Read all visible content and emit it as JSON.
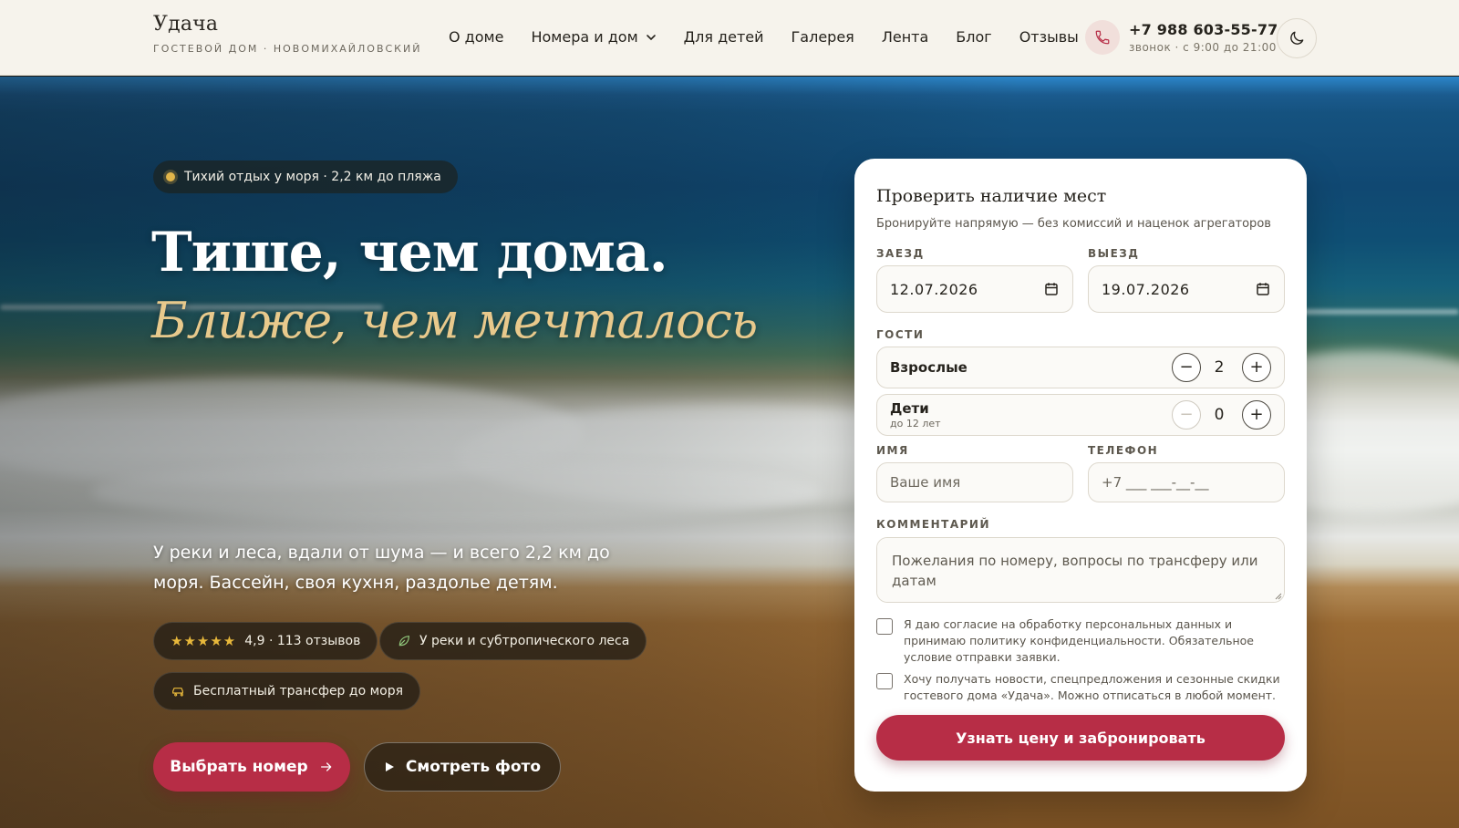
{
  "brand": {
    "name": "Удача",
    "subtitle": "ГОСТЕВОЙ ДОМ · НОВОМИХАЙЛОВСКИЙ"
  },
  "nav": {
    "about": "О доме",
    "rooms": "Номера и дом",
    "kids": "Для детей",
    "gallery": "Галерея",
    "feed": "Лента",
    "blog": "Блог",
    "reviews": "Отзывы"
  },
  "contact": {
    "phone": "+7 988 603-55-77",
    "hours": "звонок · с 9:00 до 21:00",
    "phone_icon": "phone-icon"
  },
  "theme_toggle": {
    "icon": "moon-icon"
  },
  "hero": {
    "badge": "Тихий отдых у моря · 2,2 км до пляжа",
    "title": "Тише, чем дома.",
    "title_accent": "Ближе, чем мечталось",
    "lead": "У реки и леса, вдали от шума — и всего 2,2 км до моря. Бассейн, своя кухня, раздолье детям.",
    "chips": {
      "rating": {
        "stars": "★★★★★",
        "text": "4,9 · 113 отзывов"
      },
      "nature": {
        "text": "У реки и субтропического леса",
        "icon": "leaf-icon"
      },
      "transfer": {
        "text": "Бесплатный трансфер до моря",
        "icon": "car-icon"
      }
    },
    "btn_primary": "Выбрать номер",
    "btn_secondary": "Смотреть фото"
  },
  "booking": {
    "title": "Проверить наличие мест",
    "subtitle": "Бронируйте напрямую — без комиссий и наценок агрегаторов",
    "checkin_label": "ЗАЕЗД",
    "checkin_value": "12.07.2026",
    "checkout_label": "ВЫЕЗД",
    "checkout_value": "19.07.2026",
    "guests_label": "ГОСТИ",
    "adults_label": "Взрослые",
    "adults_value": "2",
    "kids_label": "Дети",
    "kids_hint": "до 12 лет",
    "kids_value": "0",
    "name_label": "ИМЯ",
    "name_placeholder": "Ваше имя",
    "phone_label": "ТЕЛЕФОН",
    "phone_placeholder": "+7 ___ ___-__-__",
    "comment_label": "КОММЕНТАРИЙ",
    "comment_placeholder": "Пожелания по номеру, вопросы по трансферу или датам",
    "consent_text": "Я даю согласие на обработку персональных данных и принимаю политику конфиденциальности. Обязательное условие отправки заявки.",
    "newsletter_text": "Хочу получать новости, спецпредложения и сезонные скидки гостевого дома «Удача». Можно отписаться в любой момент.",
    "submit": "Узнать цену и забронировать"
  },
  "colors": {
    "accent": "#b72d46",
    "gold": "#e8c98c",
    "header_bg": "#f6f3ec"
  }
}
